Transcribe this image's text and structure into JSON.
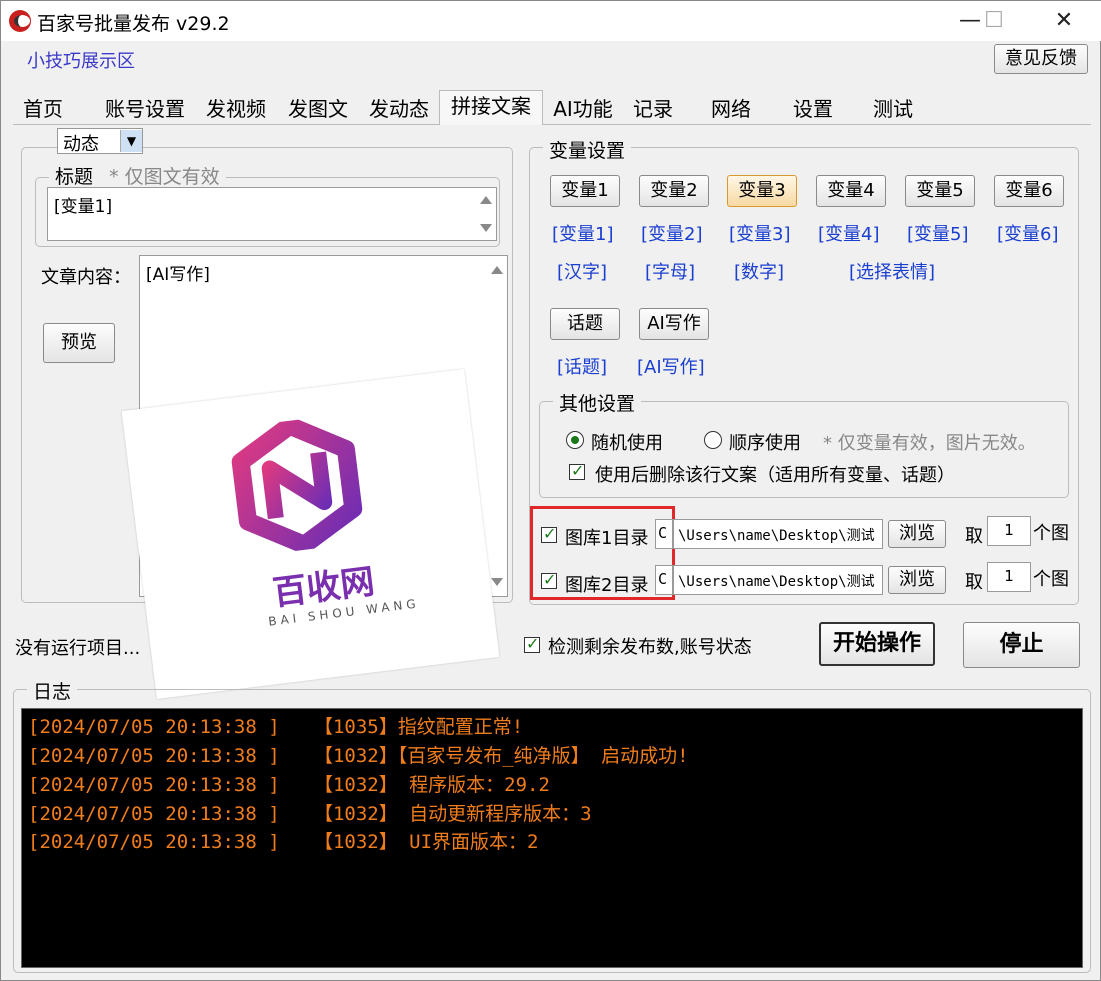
{
  "window": {
    "title": "百家号批量发布  v29.2",
    "minimize": "—",
    "maximize": "☐",
    "close": "✕"
  },
  "header": {
    "tips_link": "小技巧展示区",
    "feedback": "意见反馈"
  },
  "tabs": [
    "首页",
    "账号设置",
    "发视频",
    "发图文",
    "发动态",
    "拼接文案",
    "AI功能",
    "记录",
    "网络",
    "设置",
    "测试"
  ],
  "left": {
    "type_select": "动态",
    "title_group": "标题",
    "title_note": "* 仅图文有效",
    "title_value": "[变量1]",
    "content_label": "文章内容：",
    "content_value": "[AI写作]",
    "preview_button": "预览"
  },
  "watermark": {
    "name": "百收网",
    "subtitle": "BAI SHOU WANG"
  },
  "vars": {
    "group_title": "变量设置",
    "buttons": [
      "变量1",
      "变量2",
      "变量3",
      "变量4",
      "变量5",
      "变量6"
    ],
    "var_links": [
      "[变量1]",
      "[变量2]",
      "[变量3]",
      "[变量4]",
      "[变量5]",
      "[变量6]"
    ],
    "type_links": [
      "[汉字]",
      "[字母]",
      "[数字]",
      "[选择表情]"
    ],
    "topic_button": "话题",
    "ai_button": "AI写作",
    "topic_link": "[话题]",
    "ai_link": "[AI写作]"
  },
  "other": {
    "group_title": "其他设置",
    "random": "随机使用",
    "sequential": "顺序使用",
    "note": "* 仅变量有效，图片无效。",
    "delete_after": "使用后删除该行文案（适用所有变量、话题）"
  },
  "gallery": {
    "rows": [
      {
        "label": "图库1目录",
        "drive": "C",
        "path": "\\Users\\name\\Desktop\\测试",
        "browse": "浏览",
        "take": "取",
        "count": "1",
        "unit": "个图"
      },
      {
        "label": "图库2目录",
        "drive": "C",
        "path": "\\Users\\name\\Desktop\\测试",
        "browse": "浏览",
        "take": "取",
        "count": "1",
        "unit": "个图"
      }
    ]
  },
  "status": {
    "no_project": "没有运行项目...",
    "check_label": "检测剩余发布数,账号状态",
    "start": "开始操作",
    "stop": "停止"
  },
  "log": {
    "title": "日志",
    "lines": [
      "[2024/07/05 20:13:38 ]   【1035】指纹配置正常!",
      "[2024/07/05 20:13:38 ]   【1032】【百家号发布_纯净版】 启动成功!",
      "[2024/07/05 20:13:38 ]   【1032】 程序版本：29.2",
      "[2024/07/05 20:13:38 ]   【1032】 自动更新程序版本：3",
      "[2024/07/05 20:13:38 ]   【1032】 UI界面版本：2"
    ]
  },
  "colors": {
    "log_text": "#f07d1c",
    "link": "#1a3fd0",
    "highlight_box": "#e0282a",
    "logo_gradient_start": "#d9367e",
    "logo_gradient_end": "#6a2db5"
  }
}
